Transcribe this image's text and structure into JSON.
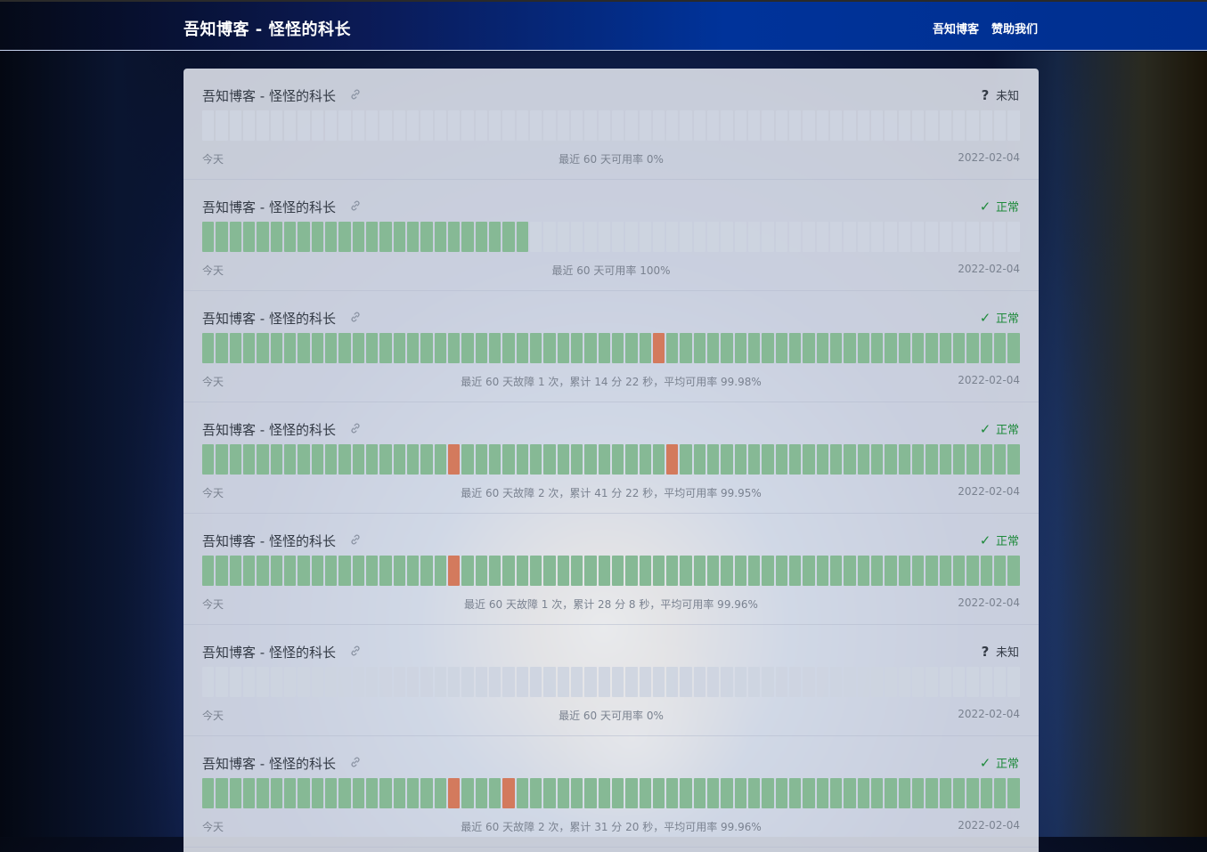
{
  "header": {
    "site_title": "吾知博客 - 怪怪的科长",
    "nav": [
      {
        "label": "吾知博客"
      },
      {
        "label": "赞助我们"
      }
    ]
  },
  "colors": {
    "up": "#86b995",
    "down": "#d37a5d",
    "none": "#cdd4e0",
    "status_ok": "#1f8a3c"
  },
  "monitors": [
    {
      "name": "吾知博客 - 怪怪的科长",
      "status": "未知",
      "status_type": "unknown",
      "today_label": "今天",
      "summary": "最近 60 天可用率 0%",
      "date": "2022-02-04",
      "up_days": 0,
      "down_indices": []
    },
    {
      "name": "吾知博客 - 怪怪的科长",
      "status": "正常",
      "status_type": "ok",
      "today_label": "今天",
      "summary": "最近 60 天可用率 100%",
      "date": "2022-02-04",
      "up_days": 24,
      "down_indices": []
    },
    {
      "name": "吾知博客 - 怪怪的科长",
      "status": "正常",
      "status_type": "ok",
      "today_label": "今天",
      "summary": "最近 60 天故障 1 次，累计 14 分 22 秒，平均可用率 99.98%",
      "date": "2022-02-04",
      "up_days": 60,
      "down_indices": [
        33
      ]
    },
    {
      "name": "吾知博客 - 怪怪的科长",
      "status": "正常",
      "status_type": "ok",
      "today_label": "今天",
      "summary": "最近 60 天故障 2 次，累计 41 分 22 秒，平均可用率 99.95%",
      "date": "2022-02-04",
      "up_days": 60,
      "down_indices": [
        18,
        34
      ]
    },
    {
      "name": "吾知博客 - 怪怪的科长",
      "status": "正常",
      "status_type": "ok",
      "today_label": "今天",
      "summary": "最近 60 天故障 1 次，累计 28 分 8 秒，平均可用率 99.96%",
      "date": "2022-02-04",
      "up_days": 60,
      "down_indices": [
        18
      ]
    },
    {
      "name": "吾知博客 - 怪怪的科长",
      "status": "未知",
      "status_type": "unknown",
      "today_label": "今天",
      "summary": "最近 60 天可用率 0%",
      "date": "2022-02-04",
      "up_days": 0,
      "down_indices": []
    },
    {
      "name": "吾知博客 - 怪怪的科长",
      "status": "正常",
      "status_type": "ok",
      "today_label": "今天",
      "summary": "最近 60 天故障 2 次，累计 31 分 20 秒，平均可用率 99.96%",
      "date": "2022-02-04",
      "up_days": 60,
      "down_indices": [
        18,
        22
      ]
    }
  ]
}
